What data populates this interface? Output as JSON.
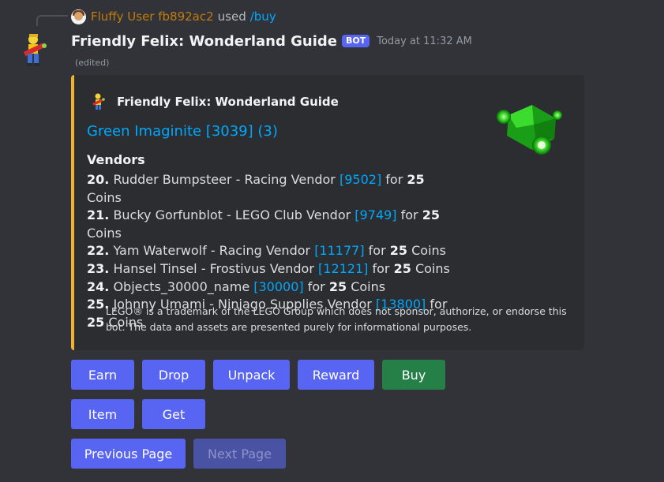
{
  "reply": {
    "username": "Fluffy User fb892ac2",
    "used_text": "used",
    "command": "/buy"
  },
  "message": {
    "bot_name": "Friendly Felix: Wonderland Guide",
    "badge": "BOT",
    "timestamp": "Today at 11:32 AM",
    "edited": "(edited)"
  },
  "embed": {
    "accent_color": "#f0b232",
    "author_name": "Friendly Felix: Wonderland Guide",
    "title": "Green Imaginite [3039] (3)",
    "field_name": "Vendors",
    "vendors": [
      {
        "num": "20.",
        "name": "Rudder Bumpsteer - Racing Vendor",
        "id": "[9502]",
        "for": "for",
        "amount": "25",
        "currency": "Coins"
      },
      {
        "num": "21.",
        "name": "Bucky Gorfunblot - LEGO Club Vendor",
        "id": "[9749]",
        "for": "for",
        "amount": "25",
        "currency": "Coins"
      },
      {
        "num": "22.",
        "name": "Yam Waterwolf - Racing Vendor",
        "id": "[11177]",
        "for": "for",
        "amount": "25",
        "currency": "Coins"
      },
      {
        "num": "23.",
        "name": "Hansel Tinsel - Frostivus Vendor",
        "id": "[12121]",
        "for": "for",
        "amount": "25",
        "currency": "Coins"
      },
      {
        "num": "24.",
        "name": "Objects_30000_name",
        "id": "[30000]",
        "for": "for",
        "amount": "25",
        "currency": "Coins"
      },
      {
        "num": "25.",
        "name": "Johnny Umami - Ninjago Supplies Vendor",
        "id": "[13800]",
        "for": "for",
        "amount": "25",
        "currency": "Coins"
      }
    ],
    "footer": "LEGO® is a trademark of the LEGO Group which does not sponsor, authorize, or endorse this bot. The data and assets are presented purely for informational purposes."
  },
  "buttons": {
    "earn": "Earn",
    "drop": "Drop",
    "unpack": "Unpack",
    "reward": "Reward",
    "buy": "Buy",
    "item": "Item",
    "get": "Get",
    "previous_page": "Previous Page",
    "next_page": "Next Page"
  },
  "colors": {
    "background": "#313338",
    "embed_background": "#2b2d31",
    "link": "#00a8fc",
    "primary_button": "#5865f2",
    "success_button": "#248046",
    "username": "#c27c0e"
  },
  "icons": {
    "avatar": "felix-avatar-icon",
    "thumbnail": "green-imaginite-icon"
  }
}
